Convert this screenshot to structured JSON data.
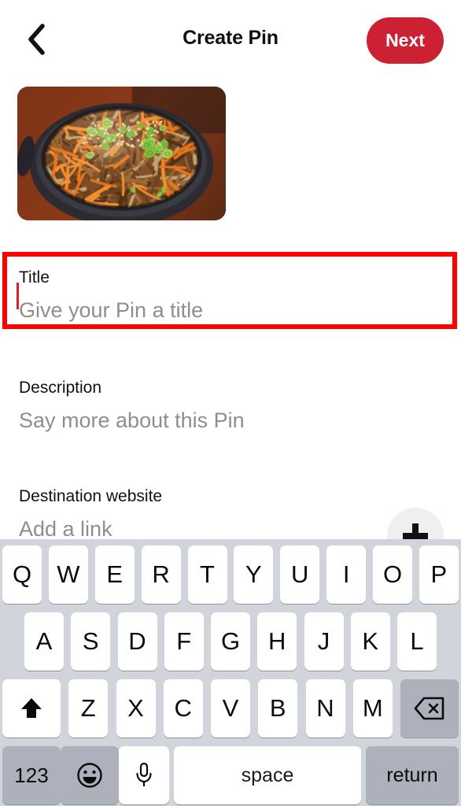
{
  "header": {
    "back_icon": "chevron-left-icon",
    "title": "Create Pin",
    "next_label": "Next"
  },
  "media": {
    "thumbnail_alt": "Korean bulgogi beef stir fry with carrots and scallions in a black cast iron pan",
    "colors": {
      "table": "#8B3A1A",
      "pan": "#2b2b31",
      "meat": "#7a4a26",
      "carrot": "#E8761B",
      "scallion": "#7FBF3F",
      "sesame": "#F2E2BC"
    }
  },
  "form": {
    "title": {
      "label": "Title",
      "placeholder": "Give your Pin a title",
      "value": "",
      "focused": true,
      "caret_color": "#E02020"
    },
    "description": {
      "label": "Description",
      "placeholder": "Say more about this Pin",
      "value": ""
    },
    "destination": {
      "label": "Destination website",
      "placeholder": "Add a link",
      "value": "",
      "add_icon": "plus-icon"
    }
  },
  "annotation": {
    "target": "title-field",
    "color": "#FF0000",
    "border_width": "6px"
  },
  "keyboard": {
    "type": "qwerty-uppercase",
    "background": "#D1D4DA",
    "row1": [
      "Q",
      "W",
      "E",
      "R",
      "T",
      "Y",
      "U",
      "I",
      "O",
      "P"
    ],
    "row2": [
      "A",
      "S",
      "D",
      "F",
      "G",
      "H",
      "J",
      "K",
      "L"
    ],
    "row3_letters": [
      "Z",
      "X",
      "C",
      "V",
      "B",
      "N",
      "M"
    ],
    "shift_icon": "shift-arrow-icon",
    "backspace_icon": "backspace-icon",
    "numbers_label": "123",
    "emoji_icon": "emoji-smiley-icon",
    "mic_icon": "microphone-icon",
    "space_label": "space",
    "return_label": "return"
  },
  "theme": {
    "brand_red": "#CC2033",
    "annotation_red": "#FF0000",
    "placeholder_gray": "#8e8e8e",
    "text_black": "#111111",
    "key_white": "#FFFFFF",
    "key_gray": "#ACB1BC"
  }
}
